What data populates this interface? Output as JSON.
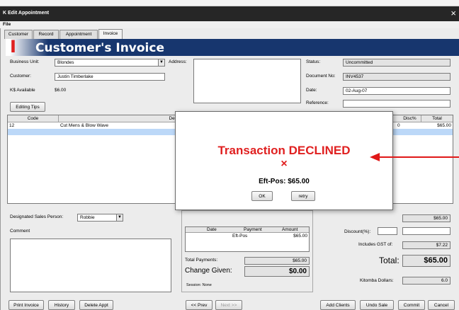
{
  "window": {
    "title": "Edit Appointment",
    "close_glyph": "×"
  },
  "menu": {
    "file": "File"
  },
  "tabs": [
    {
      "label": "Customer"
    },
    {
      "label": "Record"
    },
    {
      "label": "Appointment"
    },
    {
      "label": "Invoice"
    }
  ],
  "header": {
    "glyph": "I",
    "title": "Customer's Invoice"
  },
  "form": {
    "business_unit_label": "Business Unit:",
    "business_unit_value": "Blondes",
    "address_label": "Address:",
    "customer_label": "Customer:",
    "customer_value": "Justin Timberlake",
    "available_label": "K$ Available",
    "available_value": "$6.00",
    "status_label": "Status:",
    "status_value": "Uncommitted",
    "docno_label": "Document No:",
    "docno_value": "INV4537",
    "date_label": "Date:",
    "date_value": "02-Aug-07",
    "reference_label": "Reference:",
    "editing_tips": "Editing Tips"
  },
  "table": {
    "headers": {
      "code": "Code",
      "desc": "Des",
      "disc": "Disc%",
      "total": "Total"
    },
    "rows": [
      {
        "code": "12",
        "desc": "Cut Mens & Blow Wave",
        "disc": "0",
        "total": "$65.00"
      }
    ]
  },
  "left_panel": {
    "sales_person_label": "Designated Sales Person:",
    "sales_person_value": "Robbie",
    "comment_label": "Comment"
  },
  "payments": {
    "headers": [
      "Date",
      "Payment",
      "Amount"
    ],
    "rows": [
      {
        "date": "",
        "payment": "Eft-Pos",
        "amount": "$65.00"
      }
    ],
    "total_label": "Total Payments:",
    "total_value": "$65.00",
    "change_label": "Change Given:",
    "change_value": "$0.00",
    "session": "Session: None"
  },
  "totals": {
    "subtotal_value": "$65.00",
    "discount_label": "Discount(%):",
    "gst_label": "Includes GST of:",
    "gst_value": "$7.22",
    "total_label": "Total:",
    "total_value": "$65.00",
    "kitomba_label": "Kitomba Dollars:",
    "kitomba_value": "6.0"
  },
  "dialog": {
    "title": "Transaction DECLINED",
    "mark": "×",
    "amount": "Eft-Pos: $65.00",
    "ok": "OK",
    "retry": "retry"
  },
  "bottom": {
    "print": "Print Invoice",
    "history": "History",
    "delete": "Delete Appt",
    "prev": "<< Prev",
    "next": "Next >>",
    "add_clients": "Add Clients",
    "undo": "Undo Sale",
    "commit": "Commit",
    "cancel": "Cancel"
  },
  "colors": {
    "declined": "#e02020",
    "header_bg": "#17366e",
    "titlebar": "#2a2a2a",
    "arrow": "#e01818"
  }
}
